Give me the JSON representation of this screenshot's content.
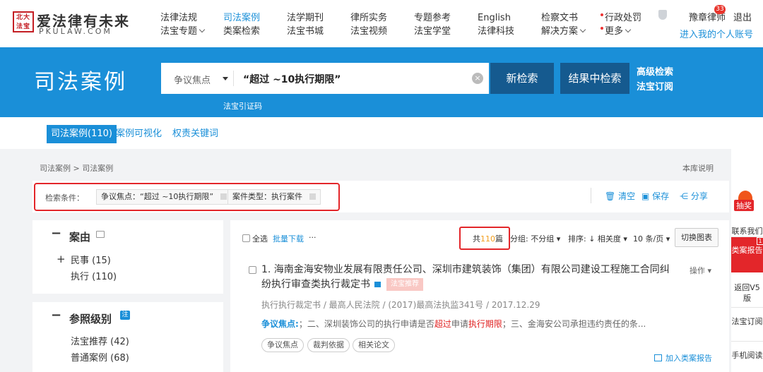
{
  "logo": {
    "seal": "北大法宝",
    "name": "爱法律有未来",
    "sub": "PKULAW.COM"
  },
  "nav": [
    {
      "top": "法律法规",
      "bottom": "法宝专题"
    },
    {
      "top": "司法案例",
      "bottom": "类案检索"
    },
    {
      "top": "法学期刊",
      "bottom": "法宝书城"
    },
    {
      "top": "律所实务",
      "bottom": "法宝视频"
    },
    {
      "top": "专题参考",
      "bottom": "法宝学堂"
    },
    {
      "top": "English",
      "bottom": "法律科技"
    },
    {
      "top": "检察文书",
      "bottom": "解决方案"
    },
    {
      "top": "行政处罚",
      "bottom": "更多"
    }
  ],
  "user": {
    "name": "豫章律师",
    "badge": "33",
    "logout": "退出",
    "personal": "进入我的个人账号"
  },
  "hero": {
    "title": "司法案例",
    "field": "争议焦点",
    "query": "“超过 ~10执行期限”",
    "new_search": "新检索",
    "search_in_results": "结果中检索",
    "advanced": "高级检索",
    "subscribe": "法宝订阅",
    "cite_code": "法宝引证码"
  },
  "tabs": [
    "司法案例(110)",
    "案例可视化",
    "权责关键词"
  ],
  "breadcrumb": "司法案例 > 司法案例",
  "library_note": "本库说明",
  "conditions": {
    "label": "检索条件：",
    "chip1": "争议焦点：“超过 ~10执行期限”",
    "chip2": "案件类型：执行案件",
    "clear": "清空",
    "save": "保存",
    "share": "分享"
  },
  "facets": {
    "cause_title": "案由",
    "cause_items": [
      "民事 (15)",
      "执行 (110)"
    ],
    "level_title": "参照级别",
    "level_badge": "注",
    "level_items": [
      "法宝推荐 (42)",
      "普通案例 (68)"
    ]
  },
  "toolbar": {
    "select_all": "全选",
    "batch_download": "批量下载",
    "more": "···",
    "count_prefix": "共",
    "count": "110",
    "count_suffix": "篇",
    "group": "分组: 不分组",
    "sort": "排序: ↓ 相关度",
    "per_page": "10 条/页",
    "switch_chart": "切换图表"
  },
  "result": {
    "title": "1. 海南金海安物业发展有限责任公司、深圳市建筑装饰（集团）有限公司建设工程施工合同纠纷执行审查类执行裁定书",
    "tag": "法宝推荐",
    "ops": "操作",
    "meta": "执行执行裁定书 / 最高人民法院 / (2017)最高法执监341号 / 2017.12.29",
    "dispute_key": "争议焦点:",
    "dispute_pre": "；二、深圳装饰公司的执行申请是否",
    "dispute_hl1": "超过",
    "dispute_mid": "申请",
    "dispute_hl2": "执行期限",
    "dispute_post": "；三、金海安公司承担违约责任的条...",
    "pills": [
      "争议焦点",
      "裁判依据",
      "相关论文"
    ],
    "add_report": "加入类案报告"
  },
  "sidebar": {
    "lottery": "抽奖",
    "contact": "联系我们",
    "report": "类案报告",
    "report_badge": "1",
    "v5": "返回V5版",
    "subscribe": "法宝订阅",
    "mobile": "手机阅读"
  }
}
